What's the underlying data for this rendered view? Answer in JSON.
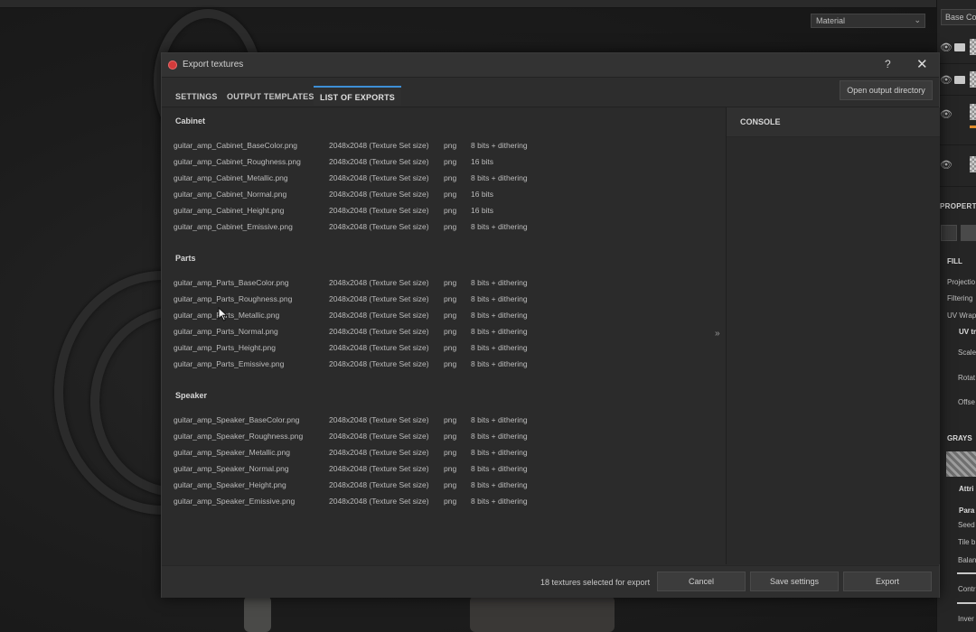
{
  "background": {
    "material_select": "Material",
    "right_panel": {
      "channel_select": "Base Colo",
      "properties_title": "PROPERT",
      "fill_label": "FILL",
      "labels": [
        "Projectio",
        "Filtering",
        "UV Wrap"
      ],
      "uv_label": "UV tr",
      "uv_labels": [
        "Scale",
        "Rotat",
        "Offse"
      ],
      "grayscale_label": "GRAYS",
      "attr_label": "Attri",
      "param_label": "Para",
      "param_labels": [
        "Seed",
        "Tile b",
        "Balan"
      ],
      "bottom_labels": [
        "Contr",
        "Inver"
      ]
    }
  },
  "dialog": {
    "title": "Export textures",
    "help": "?",
    "close": "✕",
    "tabs": [
      {
        "label": "SETTINGS"
      },
      {
        "label": "OUTPUT TEMPLATES"
      },
      {
        "label": "LIST OF EXPORTS"
      }
    ],
    "open_output_label": "Open output directory",
    "console_title": "CONSOLE",
    "expand_glyph": "»",
    "groups": [
      {
        "name": "Cabinet",
        "files": [
          {
            "name": "guitar_amp_Cabinet_BaseColor.png",
            "size": "2048x2048 (Texture Set size)",
            "format": "png",
            "bits": "8 bits + dithering"
          },
          {
            "name": "guitar_amp_Cabinet_Roughness.png",
            "size": "2048x2048 (Texture Set size)",
            "format": "png",
            "bits": "16 bits"
          },
          {
            "name": "guitar_amp_Cabinet_Metallic.png",
            "size": "2048x2048 (Texture Set size)",
            "format": "png",
            "bits": "8 bits + dithering"
          },
          {
            "name": "guitar_amp_Cabinet_Normal.png",
            "size": "2048x2048 (Texture Set size)",
            "format": "png",
            "bits": "16 bits"
          },
          {
            "name": "guitar_amp_Cabinet_Height.png",
            "size": "2048x2048 (Texture Set size)",
            "format": "png",
            "bits": "16 bits"
          },
          {
            "name": "guitar_amp_Cabinet_Emissive.png",
            "size": "2048x2048 (Texture Set size)",
            "format": "png",
            "bits": "8 bits + dithering"
          }
        ]
      },
      {
        "name": "Parts",
        "files": [
          {
            "name": "guitar_amp_Parts_BaseColor.png",
            "size": "2048x2048 (Texture Set size)",
            "format": "png",
            "bits": "8 bits + dithering"
          },
          {
            "name": "guitar_amp_Parts_Roughness.png",
            "size": "2048x2048 (Texture Set size)",
            "format": "png",
            "bits": "8 bits + dithering"
          },
          {
            "name": "guitar_amp_Parts_Metallic.png",
            "size": "2048x2048 (Texture Set size)",
            "format": "png",
            "bits": "8 bits + dithering"
          },
          {
            "name": "guitar_amp_Parts_Normal.png",
            "size": "2048x2048 (Texture Set size)",
            "format": "png",
            "bits": "8 bits + dithering"
          },
          {
            "name": "guitar_amp_Parts_Height.png",
            "size": "2048x2048 (Texture Set size)",
            "format": "png",
            "bits": "8 bits + dithering"
          },
          {
            "name": "guitar_amp_Parts_Emissive.png",
            "size": "2048x2048 (Texture Set size)",
            "format": "png",
            "bits": "8 bits + dithering"
          }
        ]
      },
      {
        "name": "Speaker",
        "files": [
          {
            "name": "guitar_amp_Speaker_BaseColor.png",
            "size": "2048x2048 (Texture Set size)",
            "format": "png",
            "bits": "8 bits + dithering"
          },
          {
            "name": "guitar_amp_Speaker_Roughness.png",
            "size": "2048x2048 (Texture Set size)",
            "format": "png",
            "bits": "8 bits + dithering"
          },
          {
            "name": "guitar_amp_Speaker_Metallic.png",
            "size": "2048x2048 (Texture Set size)",
            "format": "png",
            "bits": "8 bits + dithering"
          },
          {
            "name": "guitar_amp_Speaker_Normal.png",
            "size": "2048x2048 (Texture Set size)",
            "format": "png",
            "bits": "8 bits + dithering"
          },
          {
            "name": "guitar_amp_Speaker_Height.png",
            "size": "2048x2048 (Texture Set size)",
            "format": "png",
            "bits": "8 bits + dithering"
          },
          {
            "name": "guitar_amp_Speaker_Emissive.png",
            "size": "2048x2048 (Texture Set size)",
            "format": "png",
            "bits": "8 bits + dithering"
          }
        ]
      }
    ],
    "footer": {
      "status": "18 textures selected for export",
      "cancel": "Cancel",
      "save_settings": "Save settings",
      "export": "Export"
    }
  },
  "colors": {
    "accent": "#3d8fd6",
    "app_icon": "#d33b3b"
  }
}
